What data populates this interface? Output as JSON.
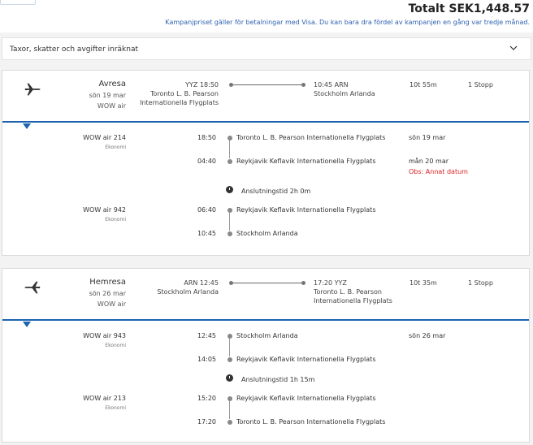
{
  "header": {
    "total": "Totalt SEK1,448.57",
    "promo": "Kampanjpriset gäller för betalningar med Visa. Du kan bara dra fördel av kampanjen en gång var tredje månad."
  },
  "taxes": {
    "label": "Taxor, skatter och avgifter inräknat"
  },
  "outbound": {
    "title": "Avresa",
    "date": "sön 19 mar",
    "airline": "WOW air",
    "dep_time": "YYZ 18:50",
    "dep_airport_1": "Toronto L. B. Pearson",
    "dep_airport_2": "Internationella Flygplats",
    "arr_time": "10:45 ARN",
    "arr_airport": "Stockholm Arlanda",
    "duration": "10t 55m",
    "stops": "1 Stopp",
    "seg1": {
      "flight": "WOW air 214",
      "class": "Ekonomi",
      "t1": "18:50",
      "a1": "Toronto L. B. Pearson Internationella Flygplats",
      "d1": "sön 19 mar",
      "t2": "04:40",
      "a2": "Reykjavik Keflavik Internationella Flygplats",
      "d2": "mån 20 mar",
      "warn": "Obs: Annat datum"
    },
    "connection": "Anslutningstid 2h 0m",
    "seg2": {
      "flight": "WOW air 942",
      "class": "Ekonomi",
      "t1": "06:40",
      "a1": "Reykjavik Keflavik Internationella Flygplats",
      "t2": "10:45",
      "a2": "Stockholm Arlanda"
    }
  },
  "return": {
    "title": "Hemresa",
    "date": "sön 26 mar",
    "airline": "WOW air",
    "dep_time": "ARN 12:45",
    "dep_airport": "Stockholm Arlanda",
    "arr_time": "17:20 YYZ",
    "arr_airport_1": "Toronto L. B. Pearson",
    "arr_airport_2": "Internationella Flygplats",
    "duration": "10t 35m",
    "stops": "1 Stopp",
    "seg1": {
      "flight": "WOW air 943",
      "class": "Ekonomi",
      "t1": "12:45",
      "a1": "Stockholm Arlanda",
      "d1": "sön 26 mar",
      "t2": "14:05",
      "a2": "Reykjavik Keflavik Internationella Flygplats"
    },
    "connection": "Anslutningstid 1h 15m",
    "seg2": {
      "flight": "WOW air 213",
      "class": "Ekonomi",
      "t1": "15:20",
      "a1": "Reykjavik Keflavik Internationella Flygplats",
      "t2": "17:20",
      "a2": "Toronto L. B. Pearson Internationella Flygplats"
    }
  },
  "icons": {
    "plane": "airplane-icon",
    "chevron": "chevron-down-icon",
    "clock": "clock-icon"
  },
  "colors": {
    "accent": "#1d63b0",
    "warning": "#d22222",
    "link": "#2f62b1"
  }
}
